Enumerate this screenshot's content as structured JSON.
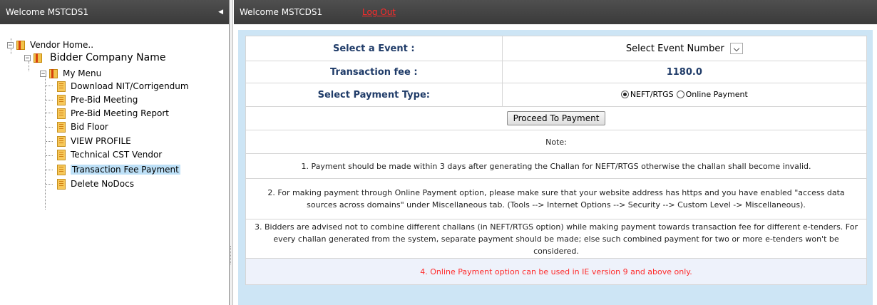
{
  "left_panel": {
    "header_title": "Welcome MSTCDS1",
    "collapse_symbol": "◀",
    "tree": {
      "root_label": "Vendor Home..",
      "company_label": "Bidder Company Name",
      "menu_label": "My Menu",
      "items": [
        {
          "label": "Download NIT/Corrigendum"
        },
        {
          "label": "Pre-Bid Meeting"
        },
        {
          "label": "Pre-Bid Meeting Report"
        },
        {
          "label": "Bid Floor"
        },
        {
          "label": "VIEW PROFILE"
        },
        {
          "label": "Technical CST Vendor"
        },
        {
          "label": "Transaction Fee Payment"
        },
        {
          "label": "Delete NoDocs"
        }
      ],
      "selected_index": 6
    }
  },
  "right_panel": {
    "header_title": "Welcome MSTCDS1",
    "logout_label": "Log Out",
    "form": {
      "event_label": "Select a Event :",
      "event_select_value": "Select Event Number",
      "fee_label": "Transaction fee :",
      "fee_value": "1180.0",
      "payment_type_label": "Select Payment Type:",
      "payment_options": [
        "NEFT/RTGS",
        "Online Payment"
      ],
      "payment_selected": "NEFT/RTGS",
      "proceed_button": "Proceed To Payment",
      "note_title": "Note:",
      "notes": [
        "1. Payment should be made within 3 days after generating the Challan for NEFT/RTGS otherwise the challan shall become invalid.",
        "2. For making payment through Online Payment option, please make sure that your website address has https and you have enabled \"access data sources across domains\" under Miscellaneous tab. (Tools --> Internet Options --> Security --> Custom Level -> Miscellaneous).",
        "3. Bidders are advised not to combine different challans (in NEFT/RTGS option) while making payment towards transaction fee for different e-tenders. For every challan generated from the system, separate payment should be made; else such combined payment for two or more e-tenders won't be considered.",
        "4. Online Payment option can be used in IE version 9 and above only."
      ]
    }
  },
  "colors": {
    "header_bg": "#444444",
    "content_bg": "#cde5f5",
    "label_text": "#1f3b68",
    "logout_text": "#ff2a2a",
    "selected_bg": "#bde0f7"
  }
}
